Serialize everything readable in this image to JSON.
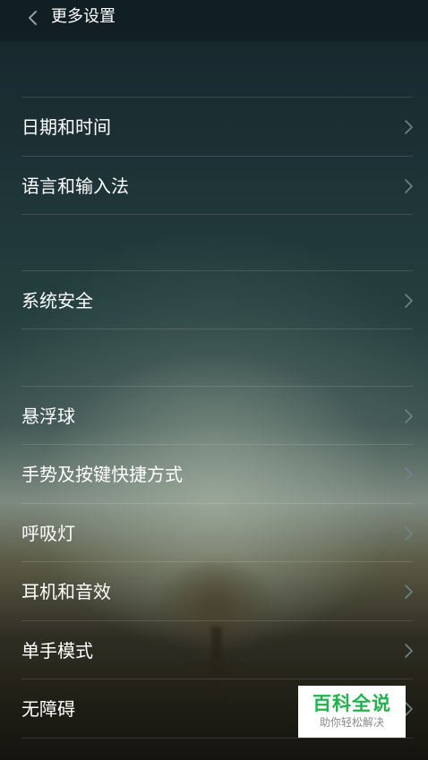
{
  "header": {
    "title": "更多设置",
    "back_icon": "chevron-left-icon"
  },
  "settings_items": [
    {
      "id": "date-time",
      "label": "日期和时间"
    },
    {
      "id": "language-input",
      "label": "语言和输入法"
    },
    {
      "id": "system-security",
      "label": "系统安全"
    },
    {
      "id": "floating-ball",
      "label": "悬浮球"
    },
    {
      "id": "gesture-shortcuts",
      "label": "手势及按键快捷方式"
    },
    {
      "id": "breathing-light",
      "label": "呼吸灯"
    },
    {
      "id": "headphones-audio",
      "label": "耳机和音效"
    },
    {
      "id": "one-hand-mode",
      "label": "单手模式"
    },
    {
      "id": "accessibility",
      "label": "无障碍"
    }
  ],
  "item_chevron_icon": "chevron-right-icon",
  "watermark": {
    "title": "百科全说",
    "subtitle": "助你轻松解决"
  },
  "colors": {
    "text": "#ffffff",
    "chevron": "#6f8488",
    "watermark_green": "#23b14d"
  }
}
